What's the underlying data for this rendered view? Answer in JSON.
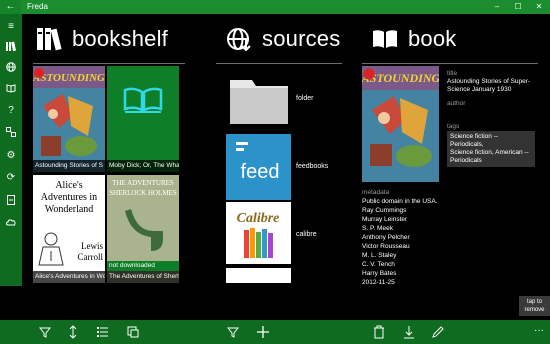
{
  "titlebar": {
    "back_icon": "back-arrow-icon",
    "title": "Freda",
    "controls": [
      "–",
      "☐",
      "✕"
    ],
    "color": "#1c8d2f"
  },
  "sidebar": {
    "icons": [
      "hamburger-menu-icon",
      "library-icon",
      "globe-icon",
      "book-open-icon",
      "help-icon",
      "link-icon",
      "settings-icon",
      "sync-icon",
      "bookmark-icon",
      "cloud-icon"
    ],
    "color": "#0e6b20"
  },
  "bookshelf": {
    "header": "bookshelf",
    "books": [
      {
        "caption": "Astounding Stories of S",
        "cover": "pulp-cover"
      },
      {
        "caption": "Moby Dick; Or, The Whal",
        "cover": "book-icon-tile"
      },
      {
        "caption": "Alice's Adventures in Wo",
        "cover": "alice-cover",
        "cover_title": "Alice's Adventures in Wonderland",
        "cover_author": "Lewis Carroll"
      },
      {
        "caption": "The Adventures of Sherl",
        "cover": "sherlock-cover",
        "status": "not downloaded",
        "cover_title_1": "THE ADVENTURES",
        "cover_title_2": "SHERLOCK HOLMES"
      }
    ]
  },
  "sources": {
    "header": "sources",
    "items": [
      {
        "label": "folder",
        "icon": "folder-icon"
      },
      {
        "label": "feedbooks",
        "icon": "feed-logo",
        "logo_text": "feed"
      },
      {
        "label": "calibre",
        "icon": "calibre-logo",
        "logo_text": "Calibre"
      }
    ]
  },
  "book": {
    "header": "book",
    "title_label": "title",
    "title_value": [
      "Astounding Stories of Super-",
      "Science January 1930"
    ],
    "author_label": "author",
    "tags_label": "tags",
    "tags_value": [
      "Science fiction -- Periodicals,",
      "Science fiction, American --",
      "Periodicals"
    ],
    "metadata_label": "metadata",
    "metadata_lines": [
      "Public domain in the USA.",
      "Ray Cummings",
      "Murray Leinster",
      "S. P. Meek",
      "Anthony Pelcher",
      "Victor Rousseau",
      "M. L. Staley",
      "C. V. Tench",
      "Harry Bates",
      "2012-11-25"
    ]
  },
  "tap_remove": [
    "tap to",
    "remove"
  ],
  "bottombar": {
    "icons": [
      "filter-icon",
      "sort-icon",
      "list-icon",
      "copy-icon",
      "filter-icon",
      "add-icon",
      "delete-icon",
      "download-icon",
      "edit-icon"
    ],
    "more": "···",
    "color": "#0e6b20"
  }
}
